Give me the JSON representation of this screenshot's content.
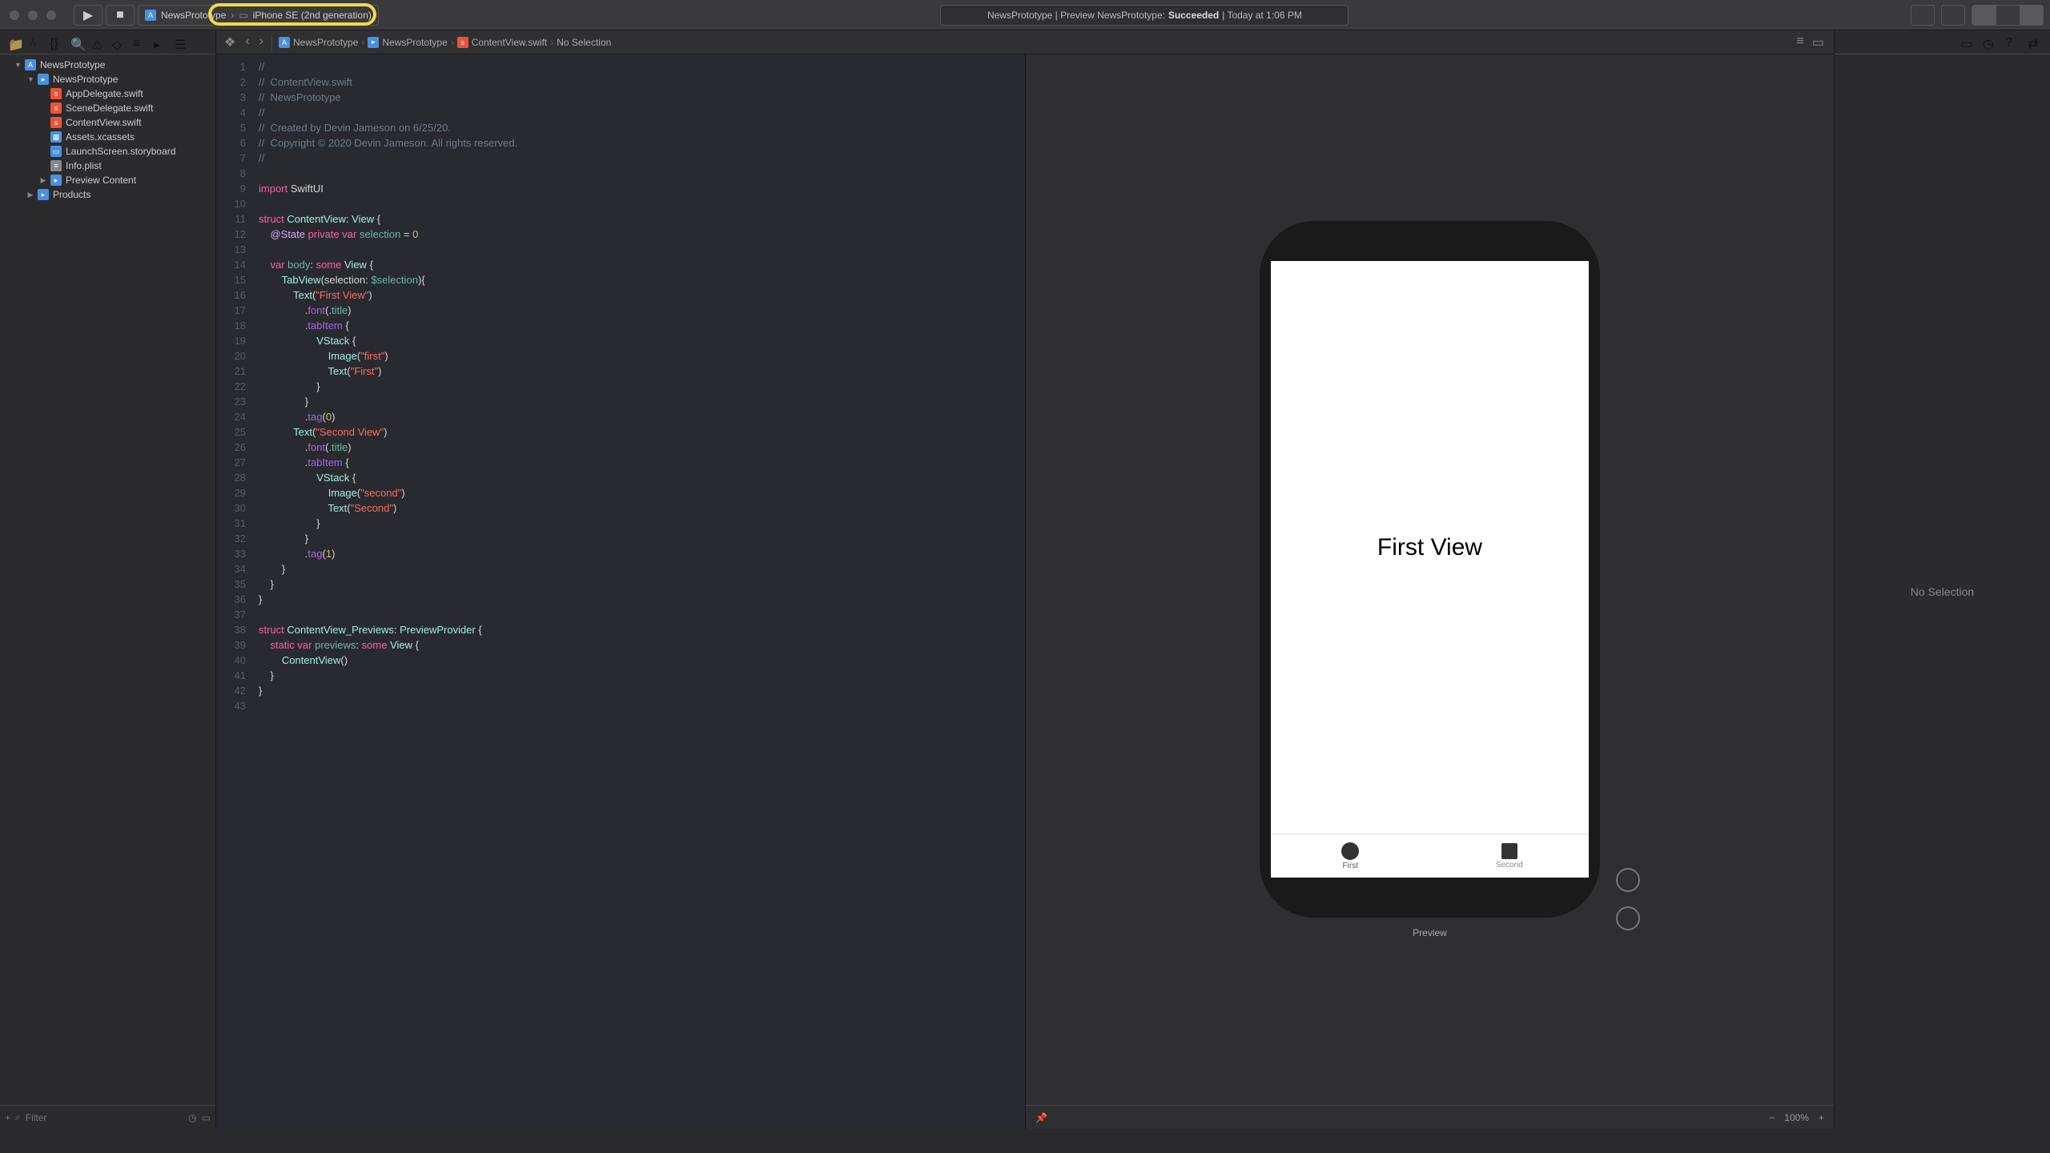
{
  "toolbar": {
    "scheme_name": "NewsPrototype",
    "device_name": "iPhone SE (2nd generation)",
    "status_prefix": "NewsPrototype | Preview NewsPrototype:",
    "status_result": "Succeeded",
    "status_time": "| Today at 1:06 PM"
  },
  "breadcrumb": {
    "items": [
      "NewsPrototype",
      "NewsPrototype",
      "ContentView.swift",
      "No Selection"
    ]
  },
  "navigator": {
    "project": "NewsPrototype",
    "group": "NewsPrototype",
    "files": [
      "AppDelegate.swift",
      "SceneDelegate.swift",
      "ContentView.swift",
      "Assets.xcassets",
      "LaunchScreen.storyboard",
      "Info.plist"
    ],
    "preview_group": "Preview Content",
    "products": "Products",
    "filter_placeholder": "Filter"
  },
  "code": {
    "lines": [
      {
        "n": 1,
        "html": "<span class='c-comment'>//</span>"
      },
      {
        "n": 2,
        "html": "<span class='c-comment'>//  ContentView.swift</span>"
      },
      {
        "n": 3,
        "html": "<span class='c-comment'>//  NewsPrototype</span>"
      },
      {
        "n": 4,
        "html": "<span class='c-comment'>//</span>"
      },
      {
        "n": 5,
        "html": "<span class='c-comment'>//  Created by Devin Jameson on 6/25/20.</span>"
      },
      {
        "n": 6,
        "html": "<span class='c-comment'>//  Copyright © 2020 Devin Jameson. All rights reserved.</span>"
      },
      {
        "n": 7,
        "html": "<span class='c-comment'>//</span>"
      },
      {
        "n": 8,
        "html": ""
      },
      {
        "n": 9,
        "html": "<span class='c-keyword'>import</span> SwiftUI"
      },
      {
        "n": 10,
        "html": ""
      },
      {
        "n": 11,
        "html": "<span class='c-keyword'>struct</span> <span class='c-type'>ContentView</span>: <span class='c-type'>View</span> {"
      },
      {
        "n": 12,
        "html": "    <span class='c-attr'>@State</span> <span class='c-keyword'>private</span> <span class='c-keyword'>var</span> <span class='c-prop'>selection</span> = <span class='c-num'>0</span>"
      },
      {
        "n": 13,
        "html": " "
      },
      {
        "n": 14,
        "html": "    <span class='c-keyword'>var</span> <span class='c-prop'>body</span>: <span class='c-keyword'>some</span> <span class='c-type'>View</span> {"
      },
      {
        "n": 15,
        "html": "        <span class='c-type'>TabView</span>(selection: <span class='c-prop'>$selection</span>){"
      },
      {
        "n": 16,
        "html": "            <span class='c-type'>Text</span>(<span class='c-string'>\"First View\"</span>)"
      },
      {
        "n": 17,
        "html": "                .<span class='c-func'>font</span>(.<span class='c-prop'>title</span>)"
      },
      {
        "n": 18,
        "html": "                .<span class='c-func'>tabItem</span> {"
      },
      {
        "n": 19,
        "html": "                    <span class='c-type'>VStack</span> {"
      },
      {
        "n": 20,
        "html": "                        <span class='c-type'>Image</span>(<span class='c-string'>\"first\"</span>)"
      },
      {
        "n": 21,
        "html": "                        <span class='c-type'>Text</span>(<span class='c-string'>\"First\"</span>)"
      },
      {
        "n": 22,
        "html": "                    }"
      },
      {
        "n": 23,
        "html": "                }"
      },
      {
        "n": 24,
        "html": "                .<span class='c-func'>tag</span>(<span class='c-num'>0</span>)"
      },
      {
        "n": 25,
        "html": "            <span class='c-type'>Text</span>(<span class='c-string'>\"Second View\"</span>)"
      },
      {
        "n": 26,
        "html": "                .<span class='c-func'>font</span>(.<span class='c-prop'>title</span>)"
      },
      {
        "n": 27,
        "html": "                .<span class='c-func'>tabItem</span> {"
      },
      {
        "n": 28,
        "html": "                    <span class='c-type'>VStack</span> {"
      },
      {
        "n": 29,
        "html": "                        <span class='c-type'>Image</span>(<span class='c-string'>\"second\"</span>)"
      },
      {
        "n": 30,
        "html": "                        <span class='c-type'>Text</span>(<span class='c-string'>\"Second\"</span>)"
      },
      {
        "n": 31,
        "html": "                    }"
      },
      {
        "n": 32,
        "html": "                }"
      },
      {
        "n": 33,
        "html": "                .<span class='c-func'>tag</span>(<span class='c-num'>1</span>)"
      },
      {
        "n": 34,
        "html": "        }"
      },
      {
        "n": 35,
        "html": "    }"
      },
      {
        "n": 36,
        "html": "}"
      },
      {
        "n": 37,
        "html": ""
      },
      {
        "n": 38,
        "html": "<span class='c-keyword'>struct</span> <span class='c-type'>ContentView_Previews</span>: <span class='c-type'>PreviewProvider</span> {"
      },
      {
        "n": 39,
        "html": "    <span class='c-keyword'>static</span> <span class='c-keyword'>var</span> <span class='c-prop'>previews</span>: <span class='c-keyword'>some</span> <span class='c-type'>View</span> {"
      },
      {
        "n": 40,
        "html": "        <span class='c-type'>ContentView</span>()"
      },
      {
        "n": 41,
        "html": "    }"
      },
      {
        "n": 42,
        "html": "}"
      },
      {
        "n": 43,
        "html": ""
      }
    ]
  },
  "preview": {
    "body_text": "First View",
    "tab1": "First",
    "tab2": "Second",
    "label": "Preview",
    "zoom": "100%"
  },
  "inspector": {
    "message": "No Selection"
  }
}
